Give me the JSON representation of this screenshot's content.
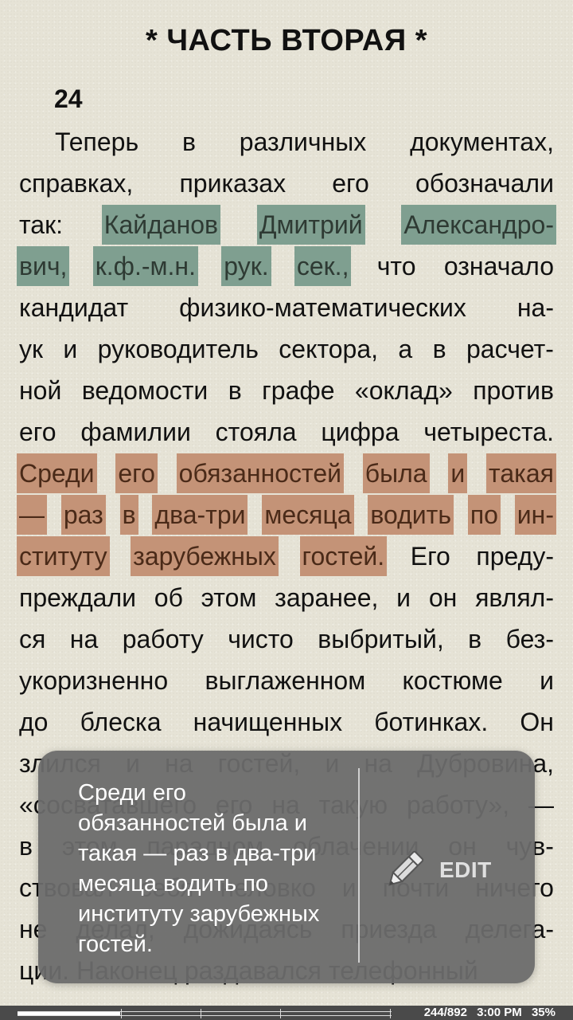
{
  "book": {
    "chapter_title": "* ЧАСТЬ ВТОРАЯ *",
    "section_number": "24",
    "lines": [
      {
        "words": [
          "Теперь",
          "в",
          "различных",
          "документах,"
        ],
        "indent": true
      },
      {
        "words": [
          "справках,",
          "приказах",
          "его",
          "обозначали"
        ]
      },
      {
        "words": [
          "так:",
          "Кайданов",
          "Дмитрий",
          "Александро-"
        ],
        "hl": {
          "start": 1,
          "end": 3,
          "color": "green"
        }
      },
      {
        "words": [
          "вич,",
          "к.ф.-м.н.",
          "рук.",
          "сек.,",
          "что",
          "означало"
        ],
        "hl": {
          "start": 0,
          "end": 3,
          "color": "green"
        }
      },
      {
        "words": [
          "кандидат",
          "физико-математических",
          "на-"
        ]
      },
      {
        "words": [
          "ук",
          "и",
          "руководитель",
          "сектора,",
          "а",
          "в",
          "расчет-"
        ]
      },
      {
        "words": [
          "ной",
          "ведомости",
          "в",
          "графе",
          "«оклад»",
          "против"
        ]
      },
      {
        "words": [
          "его",
          "фамилии",
          "стояла",
          "цифра",
          "четыреста."
        ]
      },
      {
        "words": [
          "Среди",
          "его",
          "обязанностей",
          "была",
          "и",
          "такая"
        ],
        "hl": {
          "start": 0,
          "end": 5,
          "color": "orange"
        }
      },
      {
        "words": [
          "—",
          "раз",
          "в",
          "два-три",
          "месяца",
          "водить",
          "по",
          "ин-"
        ],
        "hl": {
          "start": 0,
          "end": 7,
          "color": "orange"
        }
      },
      {
        "words": [
          "ституту",
          "зарубежных",
          "гостей.",
          "Его",
          "преду-"
        ],
        "hl": {
          "start": 0,
          "end": 2,
          "color": "orange"
        }
      },
      {
        "words": [
          "преждали",
          "об",
          "этом",
          "заранее,",
          "и",
          "он",
          "являл-"
        ]
      },
      {
        "words": [
          "ся",
          "на",
          "работу",
          "чисто",
          "выбритый,",
          "в",
          "без-"
        ]
      },
      {
        "words": [
          "укоризненно",
          "выглаженном",
          "костюме",
          "и"
        ]
      },
      {
        "words": [
          "до",
          "блеска",
          "начищенных",
          "ботинках.",
          "Он"
        ]
      },
      {
        "words": [
          "злился",
          "и",
          "на",
          "гостей,",
          "и",
          "на",
          "Дубровина,"
        ]
      },
      {
        "words": [
          "«сосватавшего",
          "его",
          "на",
          "такую",
          "работу»,",
          "—"
        ]
      },
      {
        "words": [
          "в",
          "этом",
          "парадном",
          "облачении",
          "он",
          "чув-"
        ]
      },
      {
        "words": [
          "ствовал",
          "себя",
          "неловко",
          "и",
          "почти",
          "ничего"
        ]
      },
      {
        "words": [
          "не",
          "делал,",
          "дожидаясь",
          "приезда",
          "делега-"
        ]
      },
      {
        "words": [
          "ции.",
          "Наконец",
          "раздавался",
          "телефонный"
        ],
        "last": true
      }
    ]
  },
  "popup": {
    "note_text": "Среди его обязанностей была и такая — раз в два-три месяца водить по институту зарубежных гостей.",
    "edit_label": "EDIT",
    "edit_icon": "pencil-icon"
  },
  "status": {
    "page": "244/892",
    "time": "3:00 PM",
    "battery": "35%",
    "progress": 0.274
  },
  "colors": {
    "highlight_green": "#7f9f90",
    "highlight_orange": "#c49377",
    "page_background": "#e6e3d6",
    "popup_background": "#6c6c6c"
  }
}
